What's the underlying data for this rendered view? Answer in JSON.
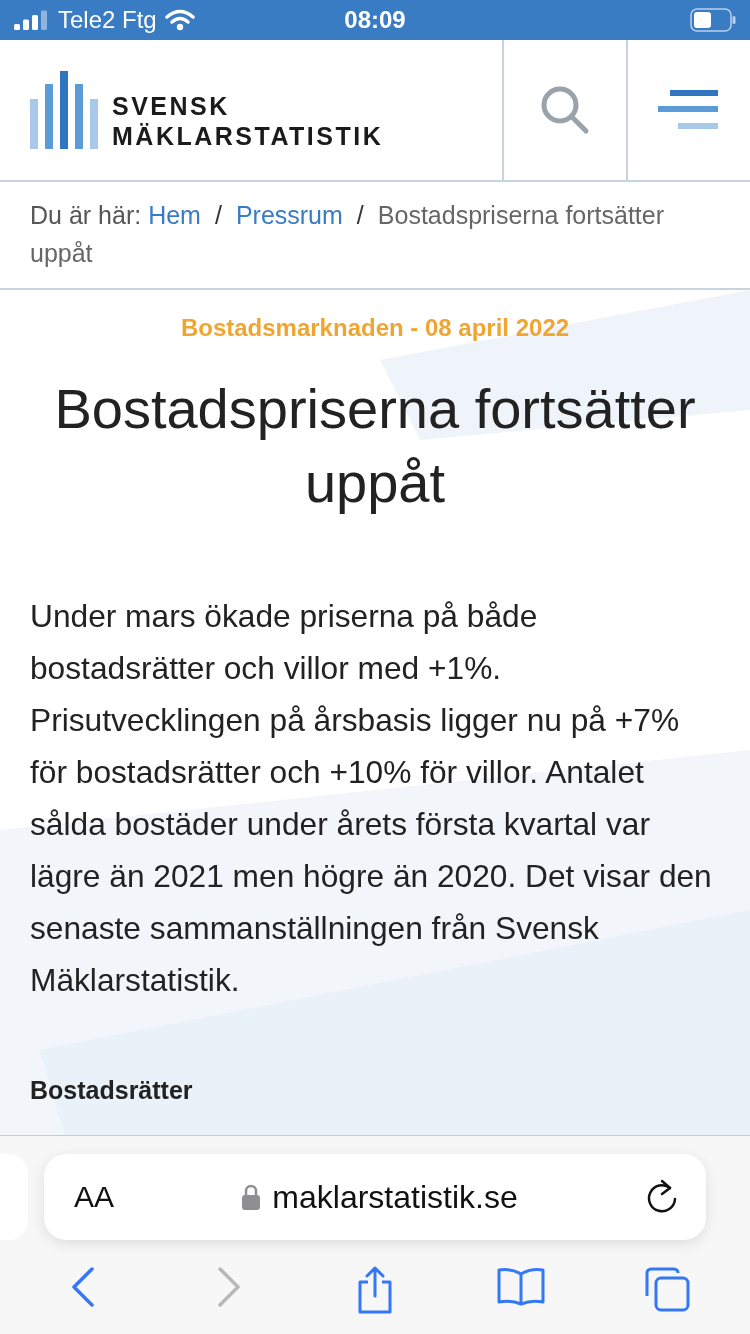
{
  "status_bar": {
    "carrier": "Tele2 Ftg",
    "time": "08:09"
  },
  "header": {
    "logo_lines": [
      "SVENSK",
      "MÄKLARSTATISTIK"
    ]
  },
  "breadcrumb": {
    "prefix": "Du är här:",
    "items": [
      {
        "label": "Hem",
        "link": true
      },
      {
        "separator": "/",
        "label": "Pressrum",
        "link": true
      },
      {
        "separator": "/",
        "label": "Bostadspriserna fortsätter uppåt",
        "link": false
      }
    ]
  },
  "article": {
    "category": "Bostadsmarknaden - 08 april 2022",
    "title": "Bostadspriserna fortsätter uppåt",
    "lead": "Under mars ökade priserna på både bostadsrätter och villor med +1%. Prisutvecklingen på årsbasis ligger nu på +7% för bostadsrätter och +10% för villor. Antalet sålda bostäder under årets första kvartal var lägre än 2021 men högre än 2020. Det visar den senaste sammanställningen från Svensk Mäklarstatistik.",
    "subheading": "Bostadsrätter"
  },
  "browser": {
    "text_size": "AA",
    "url": "maklarstatistik.se",
    "back_enabled": true,
    "forward_enabled": false
  }
}
